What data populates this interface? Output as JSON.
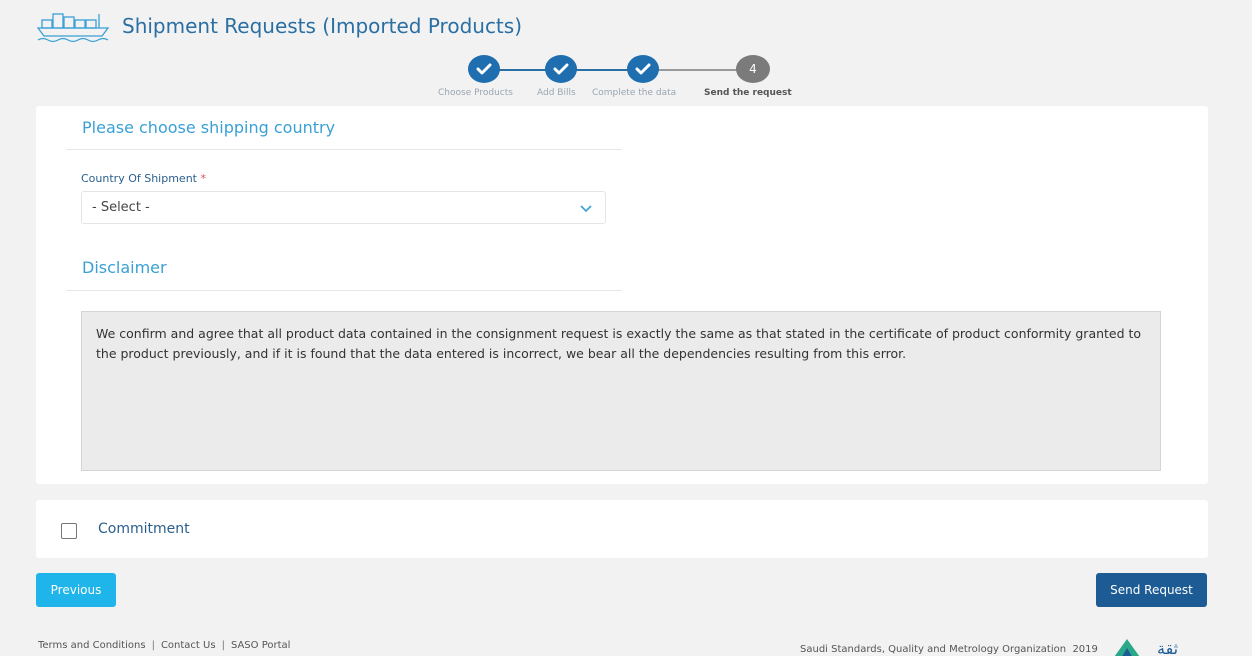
{
  "header": {
    "title": "Shipment Requests (Imported Products)"
  },
  "stepper": {
    "steps": [
      {
        "label": "Choose Products",
        "status": "done"
      },
      {
        "label": "Add Bills",
        "status": "done"
      },
      {
        "label": "Complete the data",
        "status": "done"
      },
      {
        "label": "Send the request",
        "status": "current",
        "number": "4"
      }
    ]
  },
  "shipping": {
    "section_title": "Please choose shipping country",
    "field_label": "Country Of Shipment",
    "required_mark": "*",
    "select_value": "- Select -"
  },
  "disclaimer": {
    "section_title": "Disclaimer",
    "text": "We confirm and agree that all product data contained in the consignment request is exactly the same as that stated in the certificate of product conformity granted to the product previously, and if it is found that the data entered is incorrect, we bear all the dependencies resulting from this error."
  },
  "commitment": {
    "label": "Commitment",
    "checked": false
  },
  "buttons": {
    "previous": "Previous",
    "send": "Send Request"
  },
  "footer": {
    "links": [
      "Terms and Conditions",
      "Contact Us",
      "SASO Portal"
    ],
    "separator": "|",
    "org": "Saudi Standards, Quality and Metrology Organization",
    "year": "2019"
  },
  "colors": {
    "accent": "#1f6fb0",
    "title": "#2a6fa3",
    "section": "#3aa0d6",
    "previous_button": "#1fb5ea",
    "send_button": "#1c5b94"
  }
}
